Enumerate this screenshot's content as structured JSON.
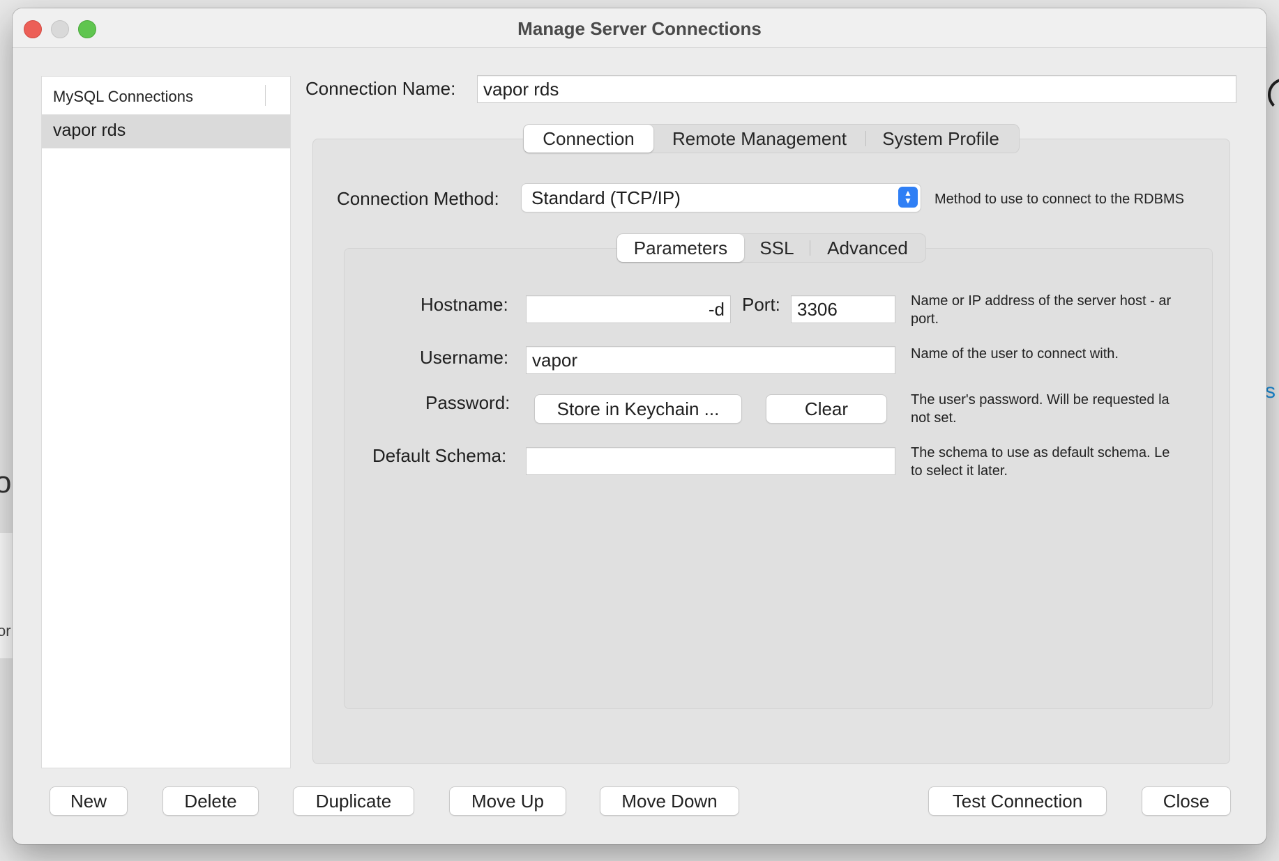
{
  "window": {
    "title": "Manage Server Connections"
  },
  "sidebar": {
    "header": "MySQL Connections",
    "items": [
      {
        "label": "vapor rds",
        "selected": true
      }
    ]
  },
  "connection_name": {
    "label": "Connection Name:",
    "value": "vapor rds"
  },
  "main_tabs": [
    {
      "label": "Connection",
      "active": true
    },
    {
      "label": "Remote Management",
      "active": false
    },
    {
      "label": "System Profile",
      "active": false
    }
  ],
  "connection_method": {
    "label": "Connection Method:",
    "value": "Standard (TCP/IP)",
    "help": "Method to use to connect to the RDBMS"
  },
  "sub_tabs": [
    {
      "label": "Parameters",
      "active": true
    },
    {
      "label": "SSL",
      "active": false
    },
    {
      "label": "Advanced",
      "active": false
    }
  ],
  "params": {
    "hostname": {
      "label": "Hostname:",
      "value": "-d",
      "help_line1": "Name or IP address of the server host - ar",
      "help_line2": "port."
    },
    "port": {
      "label": "Port:",
      "value": "3306"
    },
    "username": {
      "label": "Username:",
      "value": "vapor",
      "help": "Name of the user to connect with."
    },
    "password": {
      "label": "Password:",
      "store_label": "Store in Keychain ...",
      "clear_label": "Clear",
      "help_line1": "The user's password. Will be requested la",
      "help_line2": "not set."
    },
    "schema": {
      "label": "Default Schema:",
      "value": "",
      "help_line1": "The schema to use as default schema. Le",
      "help_line2": "to select it later."
    }
  },
  "footer": {
    "new_label": "New",
    "delete_label": "Delete",
    "duplicate_label": "Duplicate",
    "move_up_label": "Move Up",
    "move_down_label": "Move Down",
    "test_label": "Test Connection",
    "close_label": "Close"
  },
  "background": {
    "glyph_o": "o",
    "glyph_or": "or",
    "glyph_s": "s"
  },
  "colors": {
    "accent": "#2f7ff5",
    "close": "#ec5f57",
    "zoom": "#5fc54f"
  }
}
